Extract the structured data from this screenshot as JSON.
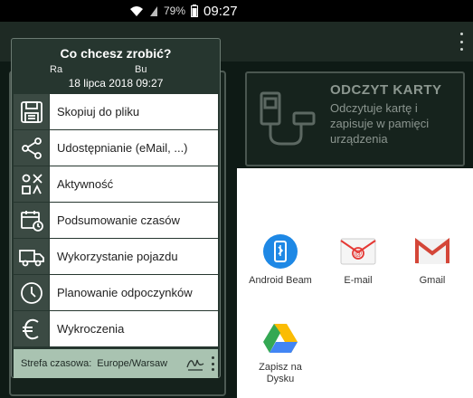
{
  "status": {
    "battery": "79%",
    "time": "09:27"
  },
  "background_card": {
    "title": "ODCZYT KARTY",
    "description": "Odczytuje kartę i zapisuje w pamięci urządzenia"
  },
  "dialog": {
    "title": "Co chcesz zrobić?",
    "header_left": "Ra",
    "header_right": "Bu",
    "datetime": "18 lipca 2018  09:27",
    "items": [
      {
        "label": "Skopiuj do pliku",
        "icon": "save-icon"
      },
      {
        "label": "Udostępnianie (eMail, ...)",
        "icon": "share-icon"
      },
      {
        "label": "Aktywność",
        "icon": "activity-icon"
      },
      {
        "label": "Podsumowanie czasów",
        "icon": "calendar-icon"
      },
      {
        "label": "Wykorzystanie pojazdu",
        "icon": "truck-icon"
      },
      {
        "label": "Planowanie odpoczynków",
        "icon": "clock-icon"
      },
      {
        "label": "Wykroczenia",
        "icon": "euro-icon"
      }
    ],
    "timezone_label": "Strefa czasowa:",
    "timezone_value": "Europe/Warsaw"
  },
  "share_sheet": {
    "items": [
      {
        "label": "Android Beam",
        "icon": "android-beam-icon"
      },
      {
        "label": "E-mail",
        "icon": "email-icon"
      },
      {
        "label": "Gmail",
        "icon": "gmail-icon"
      },
      {
        "label": "Zapisz na Dysku",
        "icon": "google-drive-icon"
      }
    ]
  },
  "colors": {
    "dialog_bg": "#26362f",
    "icon_bg": "#3b4a43",
    "timezone_bar": "#a9c3b1",
    "gmail_red": "#d44638",
    "beam_blue": "#1e88e5"
  }
}
